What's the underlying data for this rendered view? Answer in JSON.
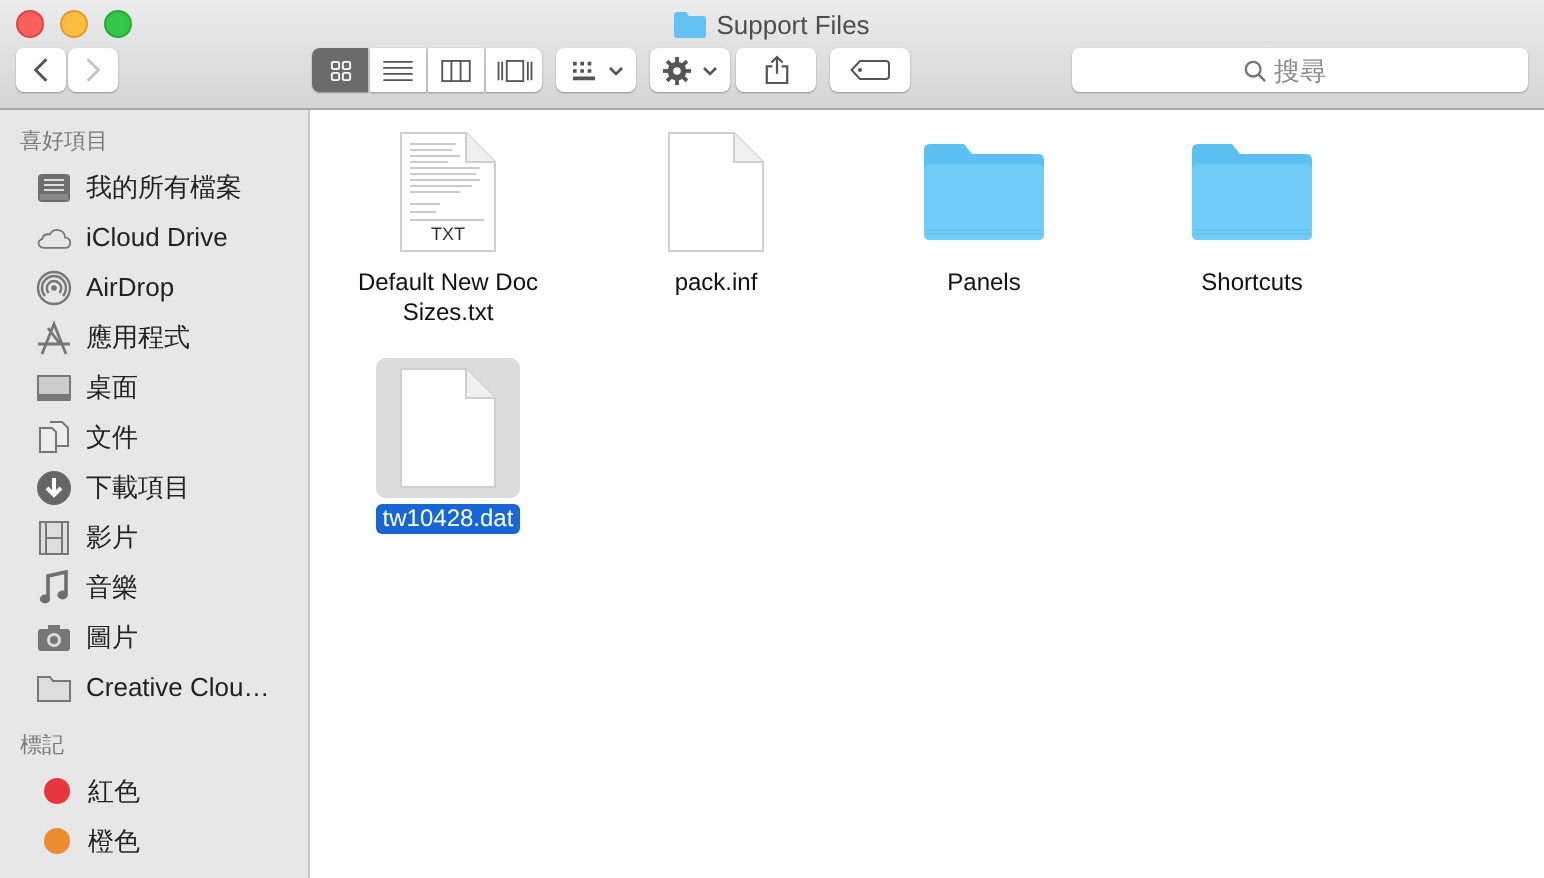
{
  "window": {
    "title": "Support Files"
  },
  "navigation": {
    "back_disabled": false,
    "forward_disabled": true
  },
  "view_modes": [
    {
      "selected": true
    },
    {
      "selected": false
    },
    {
      "selected": false
    },
    {
      "selected": false
    }
  ],
  "search": {
    "placeholder": "搜尋"
  },
  "sidebar": {
    "sections": [
      {
        "title": "喜好項目",
        "items": [
          {
            "label": "我的所有檔案"
          },
          {
            "label": "iCloud Drive"
          },
          {
            "label": "AirDrop"
          },
          {
            "label": "應用程式"
          },
          {
            "label": "桌面"
          },
          {
            "label": "文件"
          },
          {
            "label": "下載項目"
          },
          {
            "label": "影片"
          },
          {
            "label": "音樂"
          },
          {
            "label": "圖片"
          },
          {
            "label": "Creative Clou…"
          }
        ]
      },
      {
        "title": "標記",
        "items": [
          {
            "label": "紅色",
            "color": "#e8363c"
          },
          {
            "label": "橙色",
            "color": "#ec8c2e"
          }
        ]
      }
    ]
  },
  "files": [
    {
      "name": "Default New Doc Sizes.txt",
      "kind": "text",
      "badge": "TXT",
      "selected": false
    },
    {
      "name": "pack.inf",
      "kind": "file",
      "selected": false
    },
    {
      "name": "Panels",
      "kind": "folder",
      "selected": false
    },
    {
      "name": "Shortcuts",
      "kind": "folder",
      "selected": false
    },
    {
      "name": "tw10428.dat",
      "kind": "file",
      "selected": true
    }
  ]
}
